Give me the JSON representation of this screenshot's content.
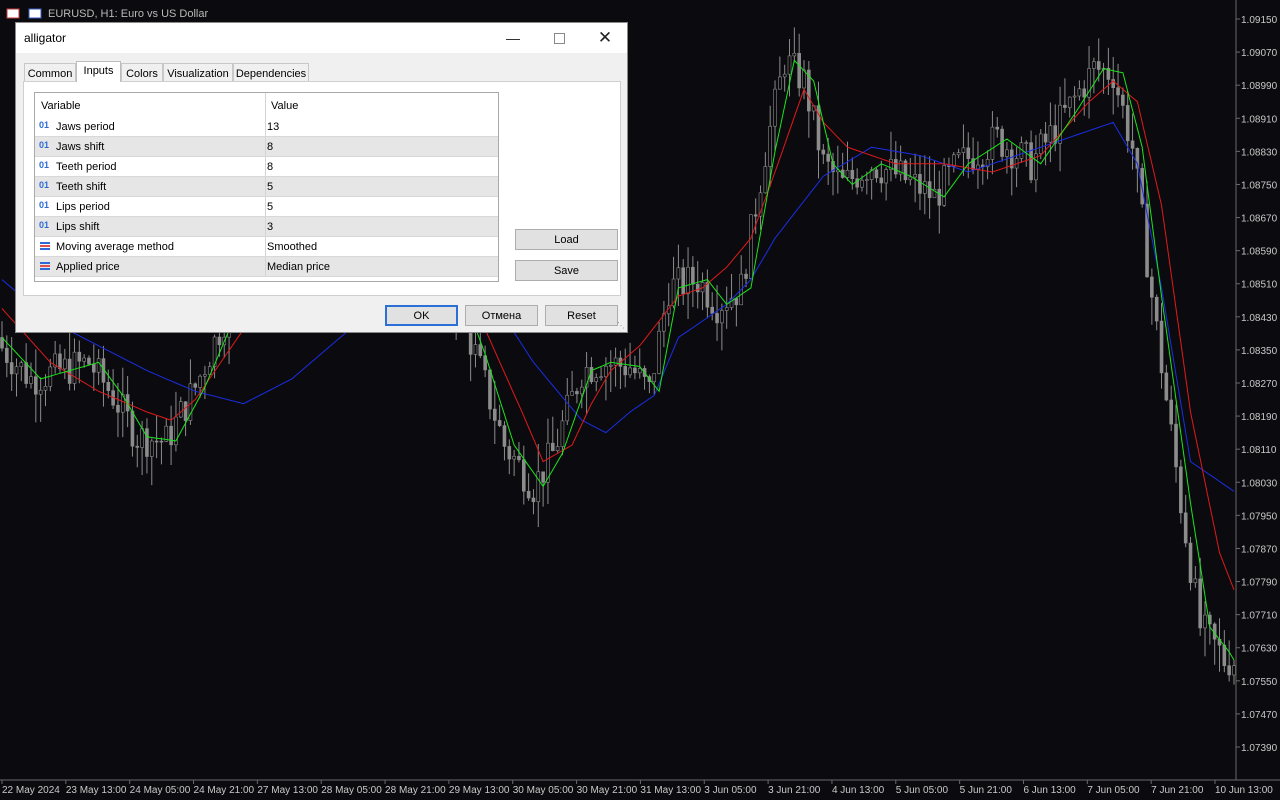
{
  "chart": {
    "title": "EURUSD, H1:  Euro vs US Dollar",
    "price_labels": [
      "1.09150",
      "1.09070",
      "1.08990",
      "1.08910",
      "1.08830",
      "1.08750",
      "1.08670",
      "1.08590",
      "1.08510",
      "1.08430",
      "1.08350",
      "1.08270",
      "1.08190",
      "1.08110",
      "1.08030",
      "1.07950",
      "1.07870",
      "1.07790",
      "1.07710",
      "1.07630",
      "1.07550",
      "1.07470",
      "1.07390"
    ],
    "time_labels": [
      "22 May 2024",
      "23 May 13:00",
      "24 May 05:00",
      "24 May 21:00",
      "27 May 13:00",
      "28 May 05:00",
      "28 May 21:00",
      "29 May 13:00",
      "30 May 05:00",
      "30 May 21:00",
      "31 May 13:00",
      "3 Jun 05:00",
      "3 Jun 21:00",
      "4 Jun 13:00",
      "5 Jun 05:00",
      "5 Jun 21:00",
      "6 Jun 13:00",
      "7 Jun 05:00",
      "7 Jun 21:00",
      "10 Jun 13:00"
    ],
    "colors": {
      "background": "#0b0b0f",
      "candles": "#8c8c8c",
      "jaws": "#1a2ee6",
      "teeth": "#e01a1a",
      "lips": "#19e619",
      "axis_text": "#c9c9c9"
    }
  },
  "chart_data": {
    "type": "line",
    "ylim": [
      1.0734,
      1.0918
    ],
    "x_count": 256,
    "series": [
      {
        "name": "Jaws",
        "color": "#1a2ee6",
        "points": [
          [
            0,
            1.0852
          ],
          [
            10,
            1.0842
          ],
          [
            20,
            1.0836
          ],
          [
            30,
            1.083
          ],
          [
            40,
            1.0825
          ],
          [
            50,
            1.0822
          ],
          [
            60,
            1.0828
          ],
          [
            70,
            1.0838
          ],
          [
            80,
            1.0848
          ],
          [
            90,
            1.0856
          ],
          [
            100,
            1.085
          ],
          [
            110,
            1.0832
          ],
          [
            120,
            1.0818
          ],
          [
            125,
            1.0815
          ],
          [
            130,
            1.082
          ],
          [
            135,
            1.0824
          ],
          [
            140,
            1.0838
          ],
          [
            145,
            1.0842
          ],
          [
            150,
            1.0846
          ],
          [
            155,
            1.0852
          ],
          [
            160,
            1.0862
          ],
          [
            170,
            1.0877
          ],
          [
            180,
            1.0884
          ],
          [
            190,
            1.0882
          ],
          [
            200,
            1.0878
          ],
          [
            210,
            1.0882
          ],
          [
            220,
            1.0886
          ],
          [
            230,
            1.089
          ],
          [
            235,
            1.088
          ],
          [
            240,
            1.085
          ],
          [
            246,
            1.0808
          ],
          [
            256,
            1.08
          ]
        ]
      },
      {
        "name": "Teeth",
        "color": "#e01a1a",
        "points": [
          [
            0,
            1.0845
          ],
          [
            10,
            1.0832
          ],
          [
            20,
            1.0825
          ],
          [
            30,
            1.082
          ],
          [
            35,
            1.0818
          ],
          [
            40,
            1.0823
          ],
          [
            50,
            1.084
          ],
          [
            60,
            1.0858
          ],
          [
            70,
            1.0862
          ],
          [
            80,
            1.0856
          ],
          [
            90,
            1.0858
          ],
          [
            100,
            1.084
          ],
          [
            108,
            1.0819
          ],
          [
            112,
            1.0808
          ],
          [
            118,
            1.0812
          ],
          [
            122,
            1.0822
          ],
          [
            126,
            1.083
          ],
          [
            132,
            1.0836
          ],
          [
            140,
            1.0848
          ],
          [
            145,
            1.085
          ],
          [
            150,
            1.0855
          ],
          [
            155,
            1.0862
          ],
          [
            160,
            1.0878
          ],
          [
            166,
            1.0898
          ],
          [
            170,
            1.089
          ],
          [
            175,
            1.0884
          ],
          [
            185,
            1.088
          ],
          [
            195,
            1.088
          ],
          [
            205,
            1.0878
          ],
          [
            215,
            1.0882
          ],
          [
            225,
            1.0895
          ],
          [
            230,
            1.09
          ],
          [
            235,
            1.0895
          ],
          [
            240,
            1.087
          ],
          [
            246,
            1.082
          ],
          [
            252,
            1.0786
          ],
          [
            256,
            1.0774
          ]
        ]
      },
      {
        "name": "Lips",
        "color": "#19e619",
        "points": [
          [
            0,
            1.0838
          ],
          [
            8,
            1.0828
          ],
          [
            14,
            1.083
          ],
          [
            20,
            1.0832
          ],
          [
            25,
            1.0824
          ],
          [
            30,
            1.0814
          ],
          [
            36,
            1.0813
          ],
          [
            42,
            1.0826
          ],
          [
            50,
            1.0848
          ],
          [
            56,
            1.0856
          ],
          [
            62,
            1.0852
          ],
          [
            70,
            1.0864
          ],
          [
            78,
            1.086
          ],
          [
            85,
            1.0862
          ],
          [
            93,
            1.0856
          ],
          [
            100,
            1.0834
          ],
          [
            106,
            1.0812
          ],
          [
            112,
            1.0802
          ],
          [
            116,
            1.081
          ],
          [
            122,
            1.083
          ],
          [
            126,
            1.0832
          ],
          [
            132,
            1.0831
          ],
          [
            136,
            1.0825
          ],
          [
            140,
            1.085
          ],
          [
            146,
            1.0852
          ],
          [
            150,
            1.0846
          ],
          [
            155,
            1.085
          ],
          [
            160,
            1.0883
          ],
          [
            164,
            1.0905
          ],
          [
            168,
            1.09
          ],
          [
            172,
            1.088
          ],
          [
            176,
            1.0875
          ],
          [
            182,
            1.088
          ],
          [
            188,
            1.0877
          ],
          [
            195,
            1.0872
          ],
          [
            200,
            1.088
          ],
          [
            208,
            1.0886
          ],
          [
            215,
            1.088
          ],
          [
            222,
            1.0892
          ],
          [
            228,
            1.0903
          ],
          [
            232,
            1.0902
          ],
          [
            236,
            1.0884
          ],
          [
            240,
            1.0848
          ],
          [
            246,
            1.0798
          ],
          [
            250,
            1.0768
          ],
          [
            254,
            1.0762
          ],
          [
            256,
            1.0758
          ]
        ]
      }
    ]
  },
  "dialog": {
    "title": "alligator",
    "tabs": [
      "Common",
      "Inputs",
      "Colors",
      "Visualization",
      "Dependencies"
    ],
    "active_tab": "Inputs",
    "table_headers": [
      "Variable",
      "Value"
    ],
    "rows": [
      {
        "icon": "01",
        "type": "int",
        "name": "Jaws period",
        "value": "13"
      },
      {
        "icon": "01",
        "type": "int",
        "name": "Jaws shift",
        "value": "8"
      },
      {
        "icon": "01",
        "type": "int",
        "name": "Teeth period",
        "value": "8"
      },
      {
        "icon": "01",
        "type": "int",
        "name": "Teeth shift",
        "value": "5"
      },
      {
        "icon": "01",
        "type": "int",
        "name": "Lips period",
        "value": "5"
      },
      {
        "icon": "01",
        "type": "int",
        "name": "Lips shift",
        "value": "3"
      },
      {
        "icon": "enum-icon",
        "type": "enum",
        "name": "Moving average method",
        "value": "Smoothed"
      },
      {
        "icon": "enum-icon",
        "type": "enum",
        "name": "Applied price",
        "value": "Median price"
      }
    ],
    "buttons": {
      "load": "Load",
      "save": "Save",
      "ok": "OK",
      "cancel": "Отмена",
      "reset": "Reset"
    }
  }
}
